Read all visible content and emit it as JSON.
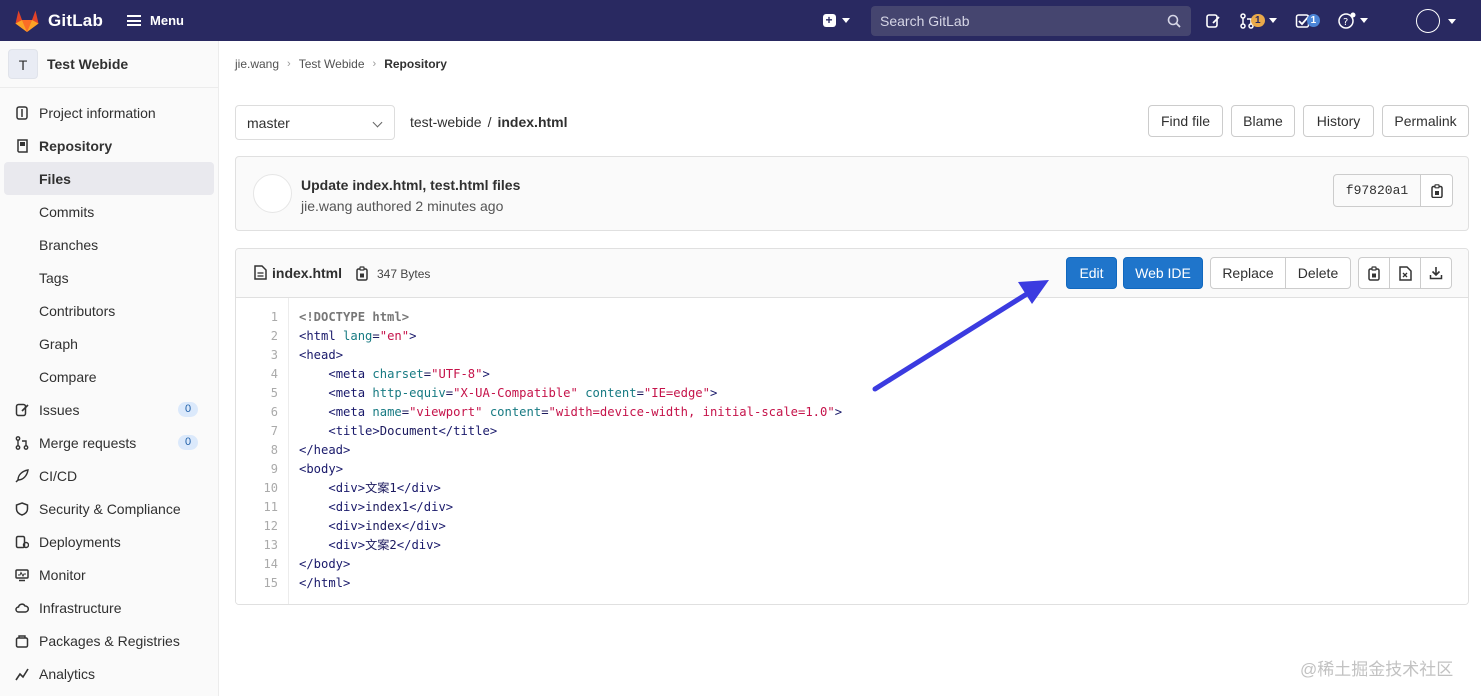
{
  "topbar": {
    "logo_text": "GitLab",
    "menu_label": "Menu",
    "search_placeholder": "Search GitLab",
    "mr_count": "1",
    "todo_count": "1"
  },
  "sidebar": {
    "project_initial": "T",
    "project_name": "Test Webide",
    "items": [
      {
        "label": "Project information",
        "icon": "info-icon"
      },
      {
        "label": "Repository",
        "icon": "repository-icon"
      },
      {
        "label": "Issues",
        "icon": "issues-icon",
        "count": "0"
      },
      {
        "label": "Merge requests",
        "icon": "merge-request-icon",
        "count": "0"
      },
      {
        "label": "CI/CD",
        "icon": "rocket-icon"
      },
      {
        "label": "Security & Compliance",
        "icon": "shield-icon"
      },
      {
        "label": "Deployments",
        "icon": "deployments-icon"
      },
      {
        "label": "Monitor",
        "icon": "monitor-icon"
      },
      {
        "label": "Infrastructure",
        "icon": "cloud-icon"
      },
      {
        "label": "Packages & Registries",
        "icon": "package-icon"
      },
      {
        "label": "Analytics",
        "icon": "chart-icon"
      }
    ],
    "repo_sub": [
      "Files",
      "Commits",
      "Branches",
      "Tags",
      "Contributors",
      "Graph",
      "Compare"
    ]
  },
  "breadcrumb": {
    "user": "jie.wang",
    "project": "Test Webide",
    "current": "Repository"
  },
  "branch": "master",
  "path": {
    "repo": "test-webide",
    "sep": "/",
    "file": "index.html"
  },
  "actions": {
    "find_file": "Find file",
    "blame": "Blame",
    "history": "History",
    "permalink": "Permalink"
  },
  "commit": {
    "title": "Update index.html, test.html files",
    "author": "jie.wang",
    "meta": "authored 2 minutes ago",
    "sha": "f97820a1"
  },
  "file": {
    "name": "index.html",
    "size": "347 Bytes",
    "edit": "Edit",
    "web_ide": "Web IDE",
    "replace": "Replace",
    "delete": "Delete"
  },
  "code_lines": [
    "<!DOCTYPE html>",
    "<html lang=\"en\">",
    "<head>",
    "    <meta charset=\"UTF-8\">",
    "    <meta http-equiv=\"X-UA-Compatible\" content=\"IE=edge\">",
    "    <meta name=\"viewport\" content=\"width=device-width, initial-scale=1.0\">",
    "    <title>Document</title>",
    "</head>",
    "<body>",
    "    <div>文案1</div>",
    "    <div>index1</div>",
    "    <div>index</div>",
    "    <div>文案2</div>",
    "</body>",
    "</html>"
  ],
  "watermark": "@稀土掘金技术社区",
  "colors": {
    "nav": "#292961",
    "primary": "#1f75cb",
    "arrow": "#3b3be0"
  }
}
